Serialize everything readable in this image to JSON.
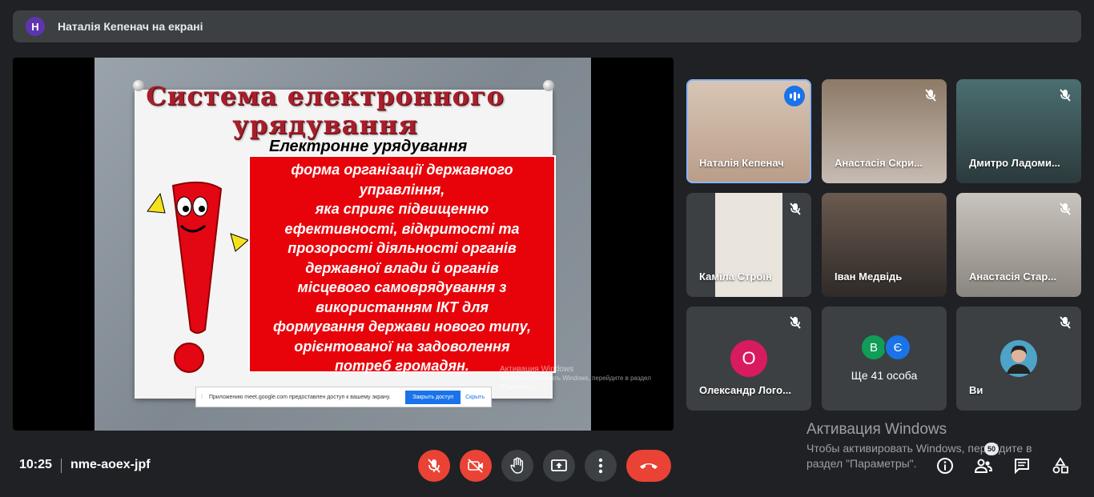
{
  "banner": {
    "avatar_letter": "Н",
    "title": "Наталія Кепенач на екрані"
  },
  "slide": {
    "title": "Система електронного урядування",
    "subtitle": "Електронне урядування",
    "definition": "форма організації державного\nуправління,\nяка сприяє підвищенню\nефективності, відкритості та\nпрозорості діяльності органів\nдержавної влади й органів\nмісцевого самоврядування з\nвикористанням ІКТ для\nформування держави нового типу,\nорієнтованої на задоволення\nпотреб громадян.",
    "share_bar": {
      "message": "Приложению meet.google.com предоставлен доступ к вашему экрану.",
      "stop_label": "Закрыть доступ",
      "hide_label": "Скрыть"
    },
    "watermark_title": "Активация Windows",
    "watermark_text": "Чтобы активировать Windows, перейдите в раздел \"Параметры\"."
  },
  "participants": [
    {
      "name": "Наталія Кепенач",
      "speaking": true,
      "muted": false
    },
    {
      "name": "Анастасія Скри...",
      "muted": true
    },
    {
      "name": "Дмитро Ладоми...",
      "muted": true
    },
    {
      "name": "Каміла Строїн",
      "muted": true
    },
    {
      "name": "Іван Медвідь",
      "muted": false
    },
    {
      "name": "Анастасія Стар...",
      "muted": true
    },
    {
      "name": "Олександр Лого...",
      "avatar_letter": "О",
      "avatar_color": "#d81b60",
      "muted": true
    },
    {
      "name": "Ще 41 особа",
      "mini_avatars": [
        {
          "letter": "В",
          "color": "#0f9d58"
        },
        {
          "letter": "Є",
          "color": "#1a73e8"
        }
      ]
    },
    {
      "name": "Ви",
      "muted": true
    }
  ],
  "bottom_bar": {
    "time": "10:25",
    "meeting_code": "nme-aoex-jpf",
    "people_badge": "50"
  },
  "watermark": {
    "title": "Активация Windows",
    "text": "Чтобы активировать Windows, перейдите в раздел \"Параметры\"."
  }
}
